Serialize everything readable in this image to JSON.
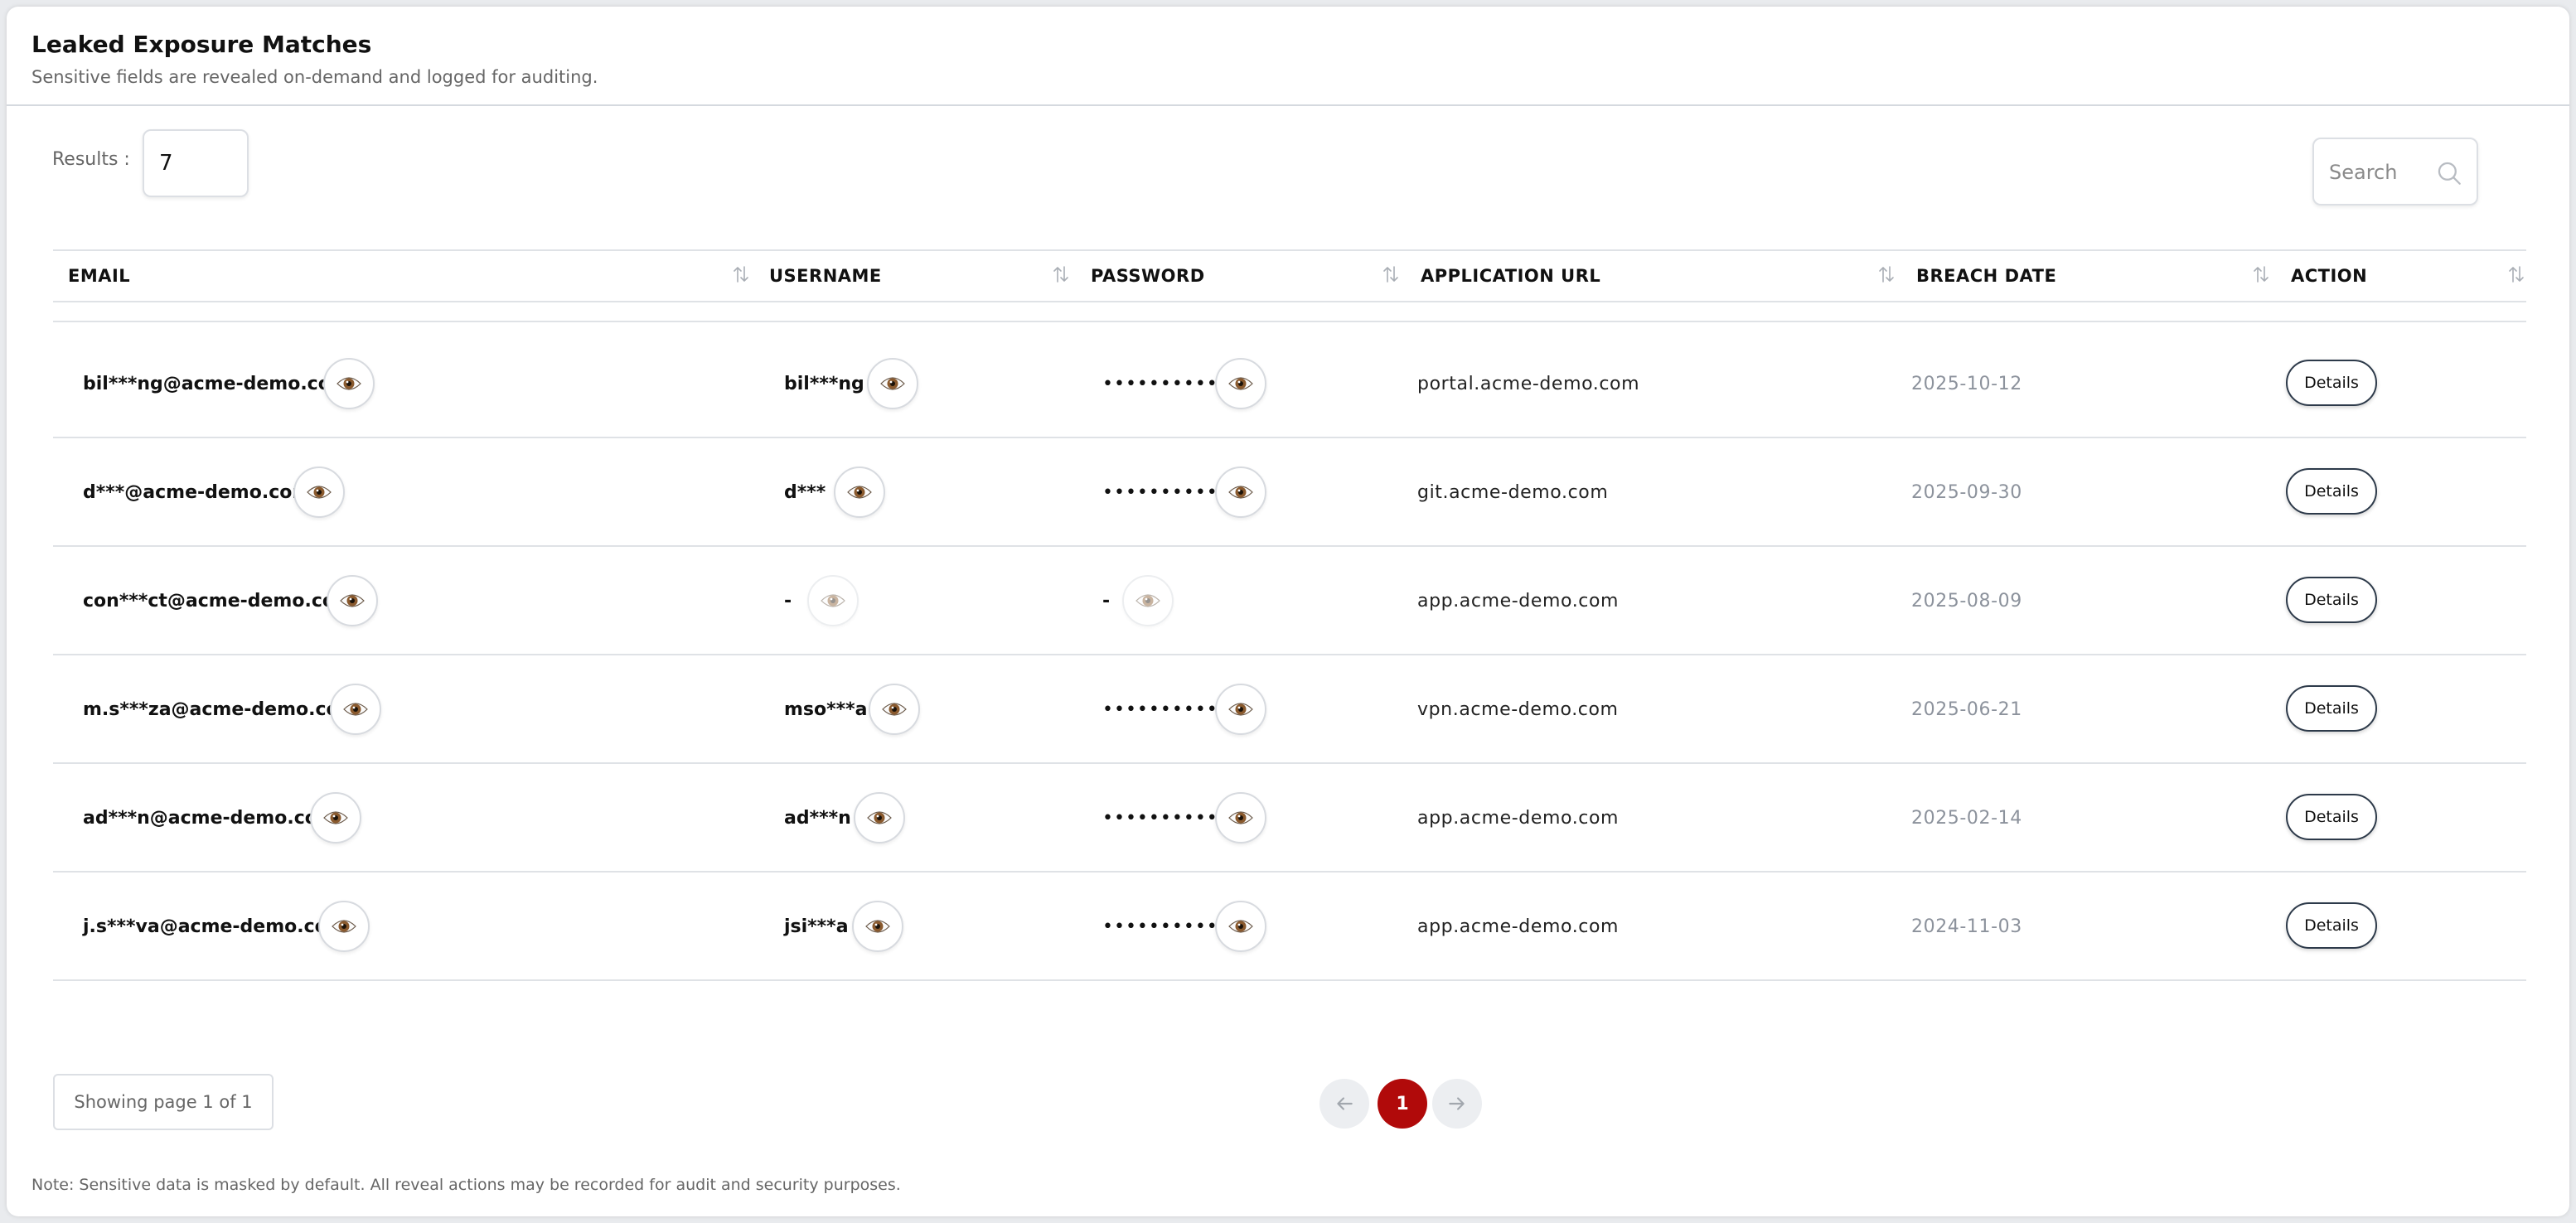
{
  "header": {
    "title": "Leaked Exposure Matches",
    "subtitle": "Sensitive fields are revealed on-demand and logged for auditing."
  },
  "controls": {
    "results_label": "Results :",
    "results_value": "7",
    "search_placeholder": "Search"
  },
  "table": {
    "columns": [
      "EMAIL",
      "USERNAME",
      "PASSWORD",
      "APPLICATION URL",
      "BREACH DATE",
      "ACTION"
    ],
    "action_label": "Details",
    "rows": [
      {
        "email": "bil***ng@acme-demo.com",
        "username": "bil***ng",
        "password": "••••••••••",
        "url": "portal.acme-demo.com",
        "date": "2025-10-12",
        "user_reveal": true,
        "pass_reveal": true
      },
      {
        "email": "d***@acme-demo.com",
        "username": "d***",
        "password": "••••••••••",
        "url": "git.acme-demo.com",
        "date": "2025-09-30",
        "user_reveal": true,
        "pass_reveal": true
      },
      {
        "email": "con***ct@acme-demo.com",
        "username": "-",
        "password": "-",
        "url": "app.acme-demo.com",
        "date": "2025-08-09",
        "user_reveal": false,
        "pass_reveal": false
      },
      {
        "email": "m.s***za@acme-demo.com",
        "username": "mso***a",
        "password": "••••••••••",
        "url": "vpn.acme-demo.com",
        "date": "2025-06-21",
        "user_reveal": true,
        "pass_reveal": true
      },
      {
        "email": "ad***n@acme-demo.com",
        "username": "ad***n",
        "password": "••••••••••",
        "url": "app.acme-demo.com",
        "date": "2025-02-14",
        "user_reveal": true,
        "pass_reveal": true
      },
      {
        "email": "j.s***va@acme-demo.com",
        "username": "jsi***a",
        "password": "••••••••••",
        "url": "app.acme-demo.com",
        "date": "2024-11-03",
        "user_reveal": true,
        "pass_reveal": true
      }
    ]
  },
  "pagination": {
    "info": "Showing page 1 of 1",
    "current_page": "1"
  },
  "footer": {
    "note": "Note: Sensitive data is masked by default. All reveal actions may be recorded for audit and security purposes."
  },
  "icons": {
    "reveal": "eye-icon",
    "sort": "sort-icon",
    "search": "search-icon",
    "prev": "arrow-left-icon",
    "next": "arrow-right-icon"
  },
  "colors": {
    "active_page": "#b10a0a",
    "date_text": "#8c929c",
    "button_border": "#2d3a4a"
  }
}
